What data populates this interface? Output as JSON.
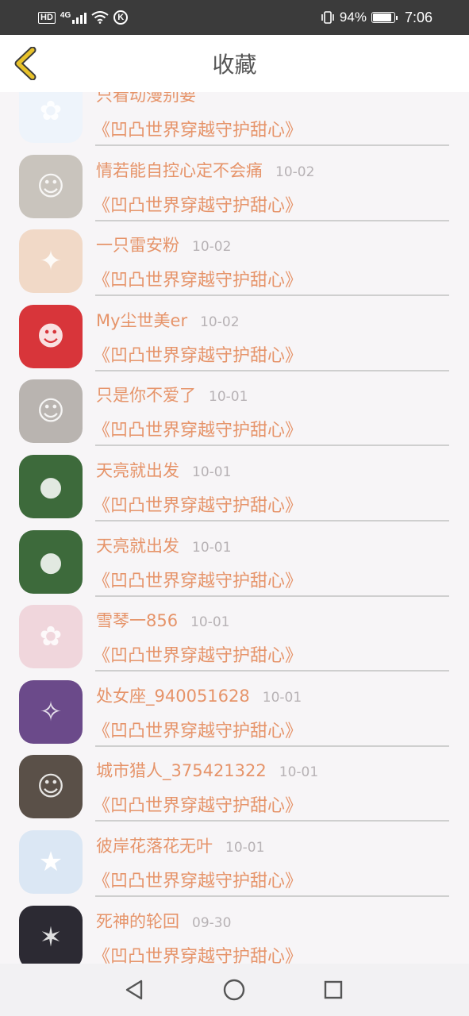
{
  "status": {
    "hd": "HD",
    "network": "4G",
    "battery_pct": "94%",
    "time": "7:06",
    "icons": [
      "signal-icon",
      "wifi-icon",
      "k-app-icon",
      "vibrate-icon",
      "battery-icon"
    ]
  },
  "header": {
    "title": "收藏",
    "back_icon": "chevron-left-icon",
    "accent": "#e8c22a"
  },
  "list": {
    "name_color": "#e6946a",
    "date_color": "#b7b2b5",
    "items": [
      {
        "name": "只看动漫别要",
        "date": "",
        "book": "《凹凸世界穿越守护甜心》",
        "avatar": "#eef4fb",
        "avatar_icon": "anime-girl-avatar"
      },
      {
        "name": "情若能自控心定不会痛",
        "date": "10-02",
        "book": "《凹凸世界穿越守护甜心》",
        "avatar": "#c9c4bd",
        "avatar_icon": "photo-avatar"
      },
      {
        "name": "一只雷安粉",
        "date": "10-02",
        "book": "《凹凸世界穿越守护甜心》",
        "avatar": "#f1d9c7",
        "avatar_icon": "cartoon-avatar"
      },
      {
        "name": "My尘世美er",
        "date": "10-02",
        "book": "《凹凸世界穿越守护甜心》",
        "avatar": "#d8353a",
        "avatar_icon": "cartoon-boy-avatar"
      },
      {
        "name": "只是你不爱了",
        "date": "10-01",
        "book": "《凹凸世界穿越守护甜心》",
        "avatar": "#b9b4b0",
        "avatar_icon": "photo-avatar"
      },
      {
        "name": "天亮就出发",
        "date": "10-01",
        "book": "《凹凸世界穿越守护甜心》",
        "avatar": "#3d6a3b",
        "avatar_icon": "teletubby-avatar"
      },
      {
        "name": "天亮就出发",
        "date": "10-01",
        "book": "《凹凸世界穿越守护甜心》",
        "avatar": "#3d6a3b",
        "avatar_icon": "teletubby-avatar"
      },
      {
        "name": "雪琴一856",
        "date": "10-01",
        "book": "《凹凸世界穿越守护甜心》",
        "avatar": "#f0d6dc",
        "avatar_icon": "anime-girl-avatar"
      },
      {
        "name": "处女座_940051628",
        "date": "10-01",
        "book": "《凹凸世界穿越守护甜心》",
        "avatar": "#6b4a8a",
        "avatar_icon": "book-cover-avatar"
      },
      {
        "name": "城市猎人_375421322",
        "date": "10-01",
        "book": "《凹凸世界穿越守护甜心》",
        "avatar": "#5a5048",
        "avatar_icon": "photo-avatar"
      },
      {
        "name": "彼岸花落花无叶",
        "date": "10-01",
        "book": "《凹凸世界穿越守护甜心》",
        "avatar": "#dbe7f4",
        "avatar_icon": "default-star-avatar"
      },
      {
        "name": "死神的轮回",
        "date": "09-30",
        "book": "《凹凸世界穿越守护甜心》",
        "avatar": "#2c2a33",
        "avatar_icon": "anime-dark-avatar"
      }
    ]
  },
  "navbar": {
    "icons": [
      "back-triangle-icon",
      "home-circle-icon",
      "recents-square-icon"
    ]
  }
}
